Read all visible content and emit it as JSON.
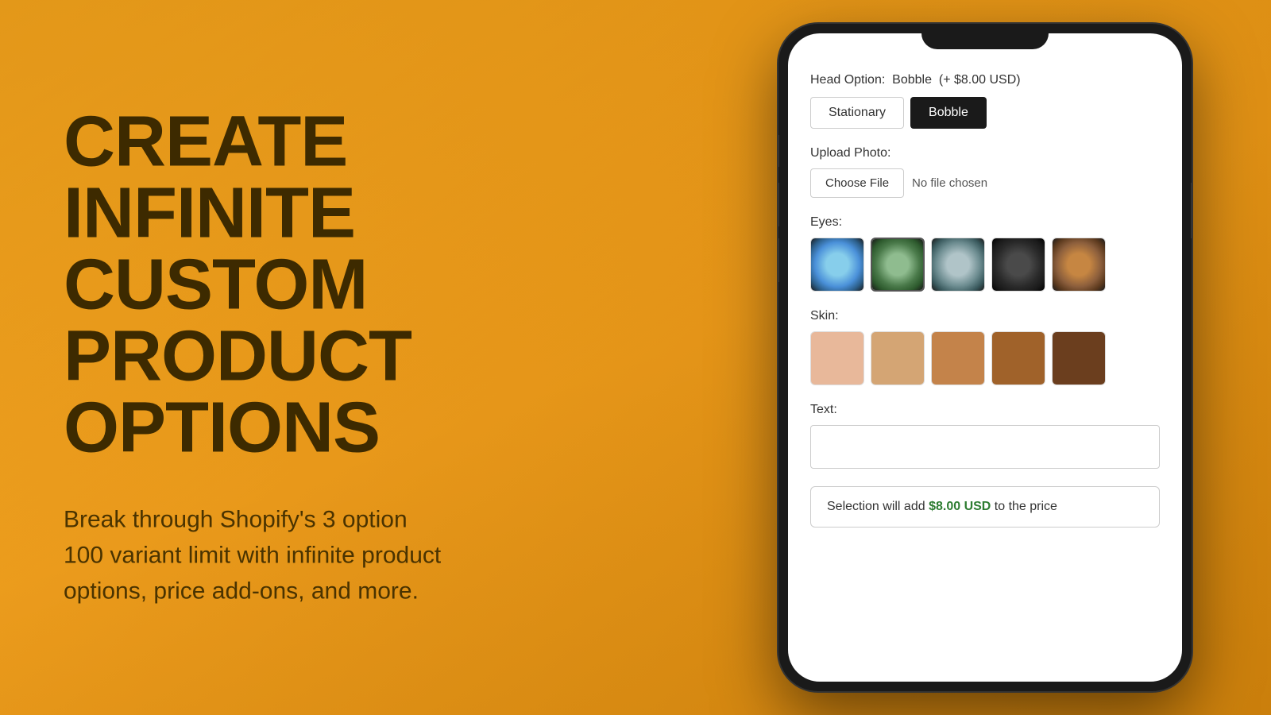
{
  "background": {
    "color": "#F5A623"
  },
  "left": {
    "headline_line1": "CREATE",
    "headline_line2": "INFINITE CUSTOM",
    "headline_line3": "PRODUCT OPTIONS",
    "subtext": "Break through Shopify's 3 option\n100 variant limit with infinite product\noptions, price add-ons, and more."
  },
  "phone": {
    "head_option": {
      "label": "Head Option:",
      "value_label": "Bobble",
      "price_label": "(+ $8.00 USD)",
      "options": [
        {
          "id": "stationary",
          "label": "Stationary",
          "active": false
        },
        {
          "id": "bobble",
          "label": "Bobble",
          "active": true
        }
      ]
    },
    "upload": {
      "label": "Upload Photo:",
      "button_label": "Choose File",
      "no_file_label": "No file chosen"
    },
    "eyes": {
      "label": "Eyes:",
      "swatches": [
        {
          "id": "eye-blue",
          "selected": false
        },
        {
          "id": "eye-green",
          "selected": true
        },
        {
          "id": "eye-gray",
          "selected": false
        },
        {
          "id": "eye-dark",
          "selected": false
        },
        {
          "id": "eye-brown",
          "selected": false
        }
      ]
    },
    "skin": {
      "label": "Skin:",
      "swatches": [
        {
          "id": "skin-1",
          "color": "#E8B89A",
          "selected": false
        },
        {
          "id": "skin-2",
          "color": "#D4A574",
          "selected": false
        },
        {
          "id": "skin-3",
          "color": "#C4834A",
          "selected": false
        },
        {
          "id": "skin-4",
          "color": "#A0622A",
          "selected": false
        },
        {
          "id": "skin-5",
          "color": "#6B3E1E",
          "selected": false
        }
      ]
    },
    "text": {
      "label": "Text:",
      "placeholder": "",
      "value": ""
    },
    "price_summary": {
      "prefix": "Selection will add ",
      "amount": "$8.00 USD",
      "suffix": " to the price"
    }
  }
}
